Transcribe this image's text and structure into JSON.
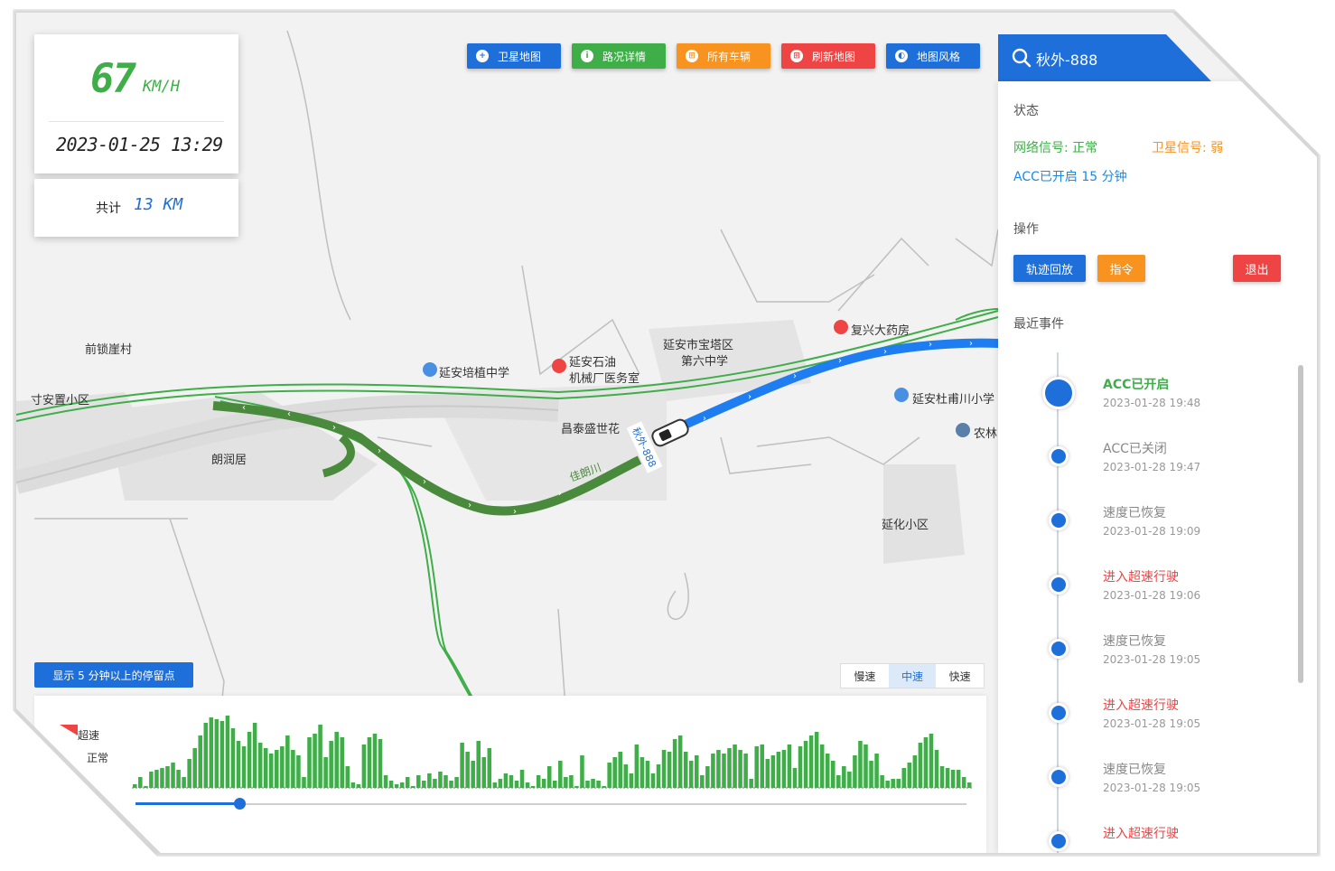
{
  "speed_card": {
    "value": "67",
    "unit": "KM/H",
    "datetime": "2023-01-25  13:29"
  },
  "distance_card": {
    "label": "共计",
    "value": "13 KM"
  },
  "toolbar": [
    {
      "label": "卫星地图",
      "color": "#1e6fd9",
      "icon": "plus-circle-icon"
    },
    {
      "label": "路况详情",
      "color": "#3fae49",
      "icon": "info-icon"
    },
    {
      "label": "所有车辆",
      "color": "#f7931e",
      "icon": "grid-icon"
    },
    {
      "label": "刷新地图",
      "color": "#ef4444",
      "icon": "grid-icon"
    },
    {
      "label": "地图风格",
      "color": "#1e6fd9",
      "icon": "contrast-icon"
    }
  ],
  "search": {
    "text": "秋外-888"
  },
  "panel": {
    "status_title": "状态",
    "network": "网络信号: 正常",
    "satellite": "卫星信号: 弱",
    "acc": "ACC已开启 15 分钟",
    "ops_title": "操作",
    "btn_replay": "轨迹回放",
    "btn_command": "指令",
    "btn_exit": "退出",
    "events_title": "最近事件",
    "events": [
      {
        "title": "ACC已开启",
        "time": "2023-01-28 19:48",
        "color": "#3fae49"
      },
      {
        "title": "ACC已关闭",
        "time": "2023-01-28 19:47",
        "color": "#888888"
      },
      {
        "title": "速度已恢复",
        "time": "2023-01-28 19:09",
        "color": "#888888"
      },
      {
        "title": "进入超速行驶",
        "time": "2023-01-28 19:06",
        "color": "#ef4444"
      },
      {
        "title": "速度已恢复",
        "time": "2023-01-28 19:05",
        "color": "#888888"
      },
      {
        "title": "进入超速行驶",
        "time": "2023-01-28 19:05",
        "color": "#ef4444"
      },
      {
        "title": "速度已恢复",
        "time": "2023-01-28 19:05",
        "color": "#888888"
      },
      {
        "title": "进入超速行驶",
        "time": "",
        "color": "#ef4444"
      }
    ]
  },
  "map_labels": {
    "l1": "前锁崖村",
    "l2": "寸安置小区",
    "l3": "延安培植中学",
    "l4": "延安石油",
    "l4b": "机械厂医务室",
    "l5": "延安市宝塔区",
    "l5b": "第六中学",
    "l6": "复兴大药房",
    "l7": "延安杜甫川小学",
    "l8": "农林",
    "l9": "昌泰盛世花",
    "l10": "朗润居",
    "l11": "延化小区",
    "l12": "佳朗川",
    "vehicle": "秋外-888"
  },
  "stop_button": "显示 5 分钟以上的停留点",
  "speed_filter": {
    "options": [
      "慢速",
      "中速",
      "快速"
    ],
    "active": 1
  },
  "speed_chart": {
    "legend": {
      "over": "超速",
      "normal": "正常"
    },
    "normal_color": "#3fae49",
    "slider_position": 0.125
  },
  "chart_data": {
    "type": "bar",
    "series": [
      {
        "name": "正常",
        "values": [
          4,
          12,
          2,
          18,
          20,
          22,
          24,
          28,
          20,
          12,
          32,
          44,
          58,
          72,
          78,
          76,
          74,
          80,
          66,
          52,
          46,
          62,
          72,
          50,
          44,
          38,
          42,
          46,
          58,
          42,
          36,
          12,
          56,
          60,
          70,
          34,
          52,
          62,
          56,
          24,
          6,
          4,
          48,
          56,
          60,
          54,
          14,
          8,
          4,
          6,
          12,
          2,
          14,
          8,
          16,
          10,
          18,
          14,
          8,
          12,
          50,
          40,
          30,
          52,
          34,
          44,
          6,
          10,
          16,
          14,
          8,
          20,
          6,
          2,
          14,
          10,
          24,
          8,
          30,
          12,
          14,
          2,
          36,
          8,
          10,
          8,
          2,
          28,
          34,
          40,
          26,
          16,
          48,
          34,
          30,
          16,
          26,
          42,
          40,
          54,
          58,
          40,
          30,
          36,
          14,
          24,
          38,
          42,
          38,
          44,
          48,
          42,
          38,
          10,
          46,
          48,
          32,
          36,
          40,
          42,
          48,
          22,
          46,
          52,
          58,
          62,
          48,
          38,
          30,
          14,
          24,
          18,
          36,
          52,
          48,
          30,
          38,
          14,
          8,
          10,
          10,
          22,
          28,
          36,
          50,
          56,
          60,
          42,
          24,
          22,
          20,
          20,
          12,
          6
        ]
      }
    ],
    "ylim": [
      0,
      80
    ]
  }
}
